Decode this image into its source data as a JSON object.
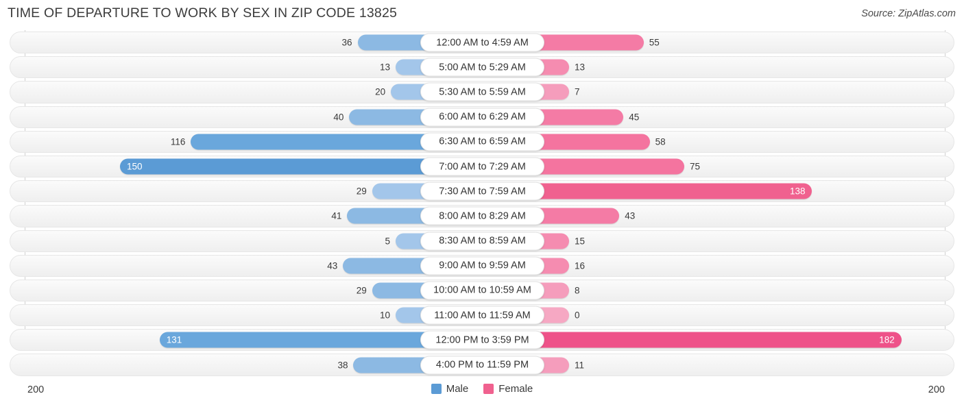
{
  "header": {
    "title": "TIME OF DEPARTURE TO WORK BY SEX IN ZIP CODE 13825",
    "source": "Source: ZipAtlas.com"
  },
  "legend": {
    "items": [
      {
        "label": "Male",
        "color": "#5b9bd5"
      },
      {
        "label": "Female",
        "color": "#f0618f"
      }
    ]
  },
  "axis": {
    "left_label": "200",
    "right_label": "200",
    "max": 200
  },
  "colors": {
    "male_light": "#a3c6ea",
    "male_mid": "#8cb9e3",
    "male_dark": "#5b9bd5",
    "female_light": "#f4a0bd",
    "female_mid": "#f happy",
    "female_dark": "#f0618f"
  },
  "chart_data": {
    "type": "bar",
    "title": "TIME OF DEPARTURE TO WORK BY SEX IN ZIP CODE 13825",
    "subtitle": "Source: ZipAtlas.com",
    "orientation": "horizontal-diverging",
    "xlabel": "",
    "ylabel": "",
    "xlim": [
      200,
      200
    ],
    "grid": false,
    "legend_position": "bottom-center",
    "categories": [
      "12:00 AM to 4:59 AM",
      "5:00 AM to 5:29 AM",
      "5:30 AM to 5:59 AM",
      "6:00 AM to 6:29 AM",
      "6:30 AM to 6:59 AM",
      "7:00 AM to 7:29 AM",
      "7:30 AM to 7:59 AM",
      "8:00 AM to 8:29 AM",
      "8:30 AM to 8:59 AM",
      "9:00 AM to 9:59 AM",
      "10:00 AM to 10:59 AM",
      "11:00 AM to 11:59 AM",
      "12:00 PM to 3:59 PM",
      "4:00 PM to 11:59 PM"
    ],
    "series": [
      {
        "name": "Male",
        "values": [
          36,
          13,
          20,
          40,
          116,
          150,
          29,
          41,
          5,
          43,
          29,
          10,
          131,
          38
        ]
      },
      {
        "name": "Female",
        "values": [
          55,
          13,
          7,
          45,
          58,
          75,
          138,
          43,
          15,
          16,
          8,
          0,
          182,
          11
        ]
      }
    ]
  },
  "rows": [
    {
      "label": "12:00 AM to 4:59 AM",
      "male": "36",
      "female": "55",
      "male_val": 36,
      "female_val": 55,
      "male_color": "#8cb9e3",
      "female_color": "#f47ba5",
      "male_inside": false,
      "female_inside": false
    },
    {
      "label": "5:00 AM to 5:29 AM",
      "male": "13",
      "female": "13",
      "male_val": 13,
      "female_val": 13,
      "male_color": "#a3c6ea",
      "female_color": "#f58cb0",
      "male_inside": false,
      "female_inside": false
    },
    {
      "label": "5:30 AM to 5:59 AM",
      "male": "20",
      "female": "7",
      "male_val": 20,
      "female_val": 7,
      "male_color": "#a3c6ea",
      "female_color": "#f59dbc",
      "male_inside": false,
      "female_inside": false
    },
    {
      "label": "6:00 AM to 6:29 AM",
      "male": "40",
      "female": "45",
      "male_val": 40,
      "female_val": 45,
      "male_color": "#8cb9e3",
      "female_color": "#f47ba5",
      "male_inside": false,
      "female_inside": false
    },
    {
      "label": "6:30 AM to 6:59 AM",
      "male": "116",
      "female": "58",
      "male_val": 116,
      "female_val": 58,
      "male_color": "#6aa7dc",
      "female_color": "#f4749f",
      "male_inside": false,
      "female_inside": false
    },
    {
      "label": "7:00 AM to 7:29 AM",
      "male": "150",
      "female": "75",
      "male_val": 150,
      "female_val": 75,
      "male_color": "#5b9bd5",
      "female_color": "#f4749f",
      "male_inside": true,
      "female_inside": false
    },
    {
      "label": "7:30 AM to 7:59 AM",
      "male": "29",
      "female": "138",
      "male_val": 29,
      "female_val": 138,
      "male_color": "#a3c6ea",
      "female_color": "#f0618f",
      "male_inside": false,
      "female_inside": true
    },
    {
      "label": "8:00 AM to 8:29 AM",
      "male": "41",
      "female": "43",
      "male_val": 41,
      "female_val": 43,
      "male_color": "#8cb9e3",
      "female_color": "#f47ba5",
      "male_inside": false,
      "female_inside": false
    },
    {
      "label": "8:30 AM to 8:59 AM",
      "male": "5",
      "female": "15",
      "male_val": 5,
      "female_val": 15,
      "male_color": "#a3c6ea",
      "female_color": "#f58cb0",
      "male_inside": false,
      "female_inside": false
    },
    {
      "label": "9:00 AM to 9:59 AM",
      "male": "43",
      "female": "16",
      "male_val": 43,
      "female_val": 16,
      "male_color": "#8cb9e3",
      "female_color": "#f58cb0",
      "male_inside": false,
      "female_inside": false
    },
    {
      "label": "10:00 AM to 10:59 AM",
      "male": "29",
      "female": "8",
      "male_val": 29,
      "female_val": 8,
      "male_color": "#8cb9e3",
      "female_color": "#f59dbc",
      "male_inside": false,
      "female_inside": false
    },
    {
      "label": "11:00 AM to 11:59 AM",
      "male": "10",
      "female": "0",
      "male_val": 10,
      "female_val": 0,
      "male_color": "#a3c6ea",
      "female_color": "#f6a8c3",
      "male_inside": false,
      "female_inside": false
    },
    {
      "label": "12:00 PM to 3:59 PM",
      "male": "131",
      "female": "182",
      "male_val": 131,
      "female_val": 182,
      "male_color": "#6aa7dc",
      "female_color": "#ee5289",
      "male_inside": true,
      "female_inside": true
    },
    {
      "label": "4:00 PM to 11:59 PM",
      "male": "38",
      "female": "11",
      "male_val": 38,
      "female_val": 11,
      "male_color": "#8cb9e3",
      "female_color": "#f59dbc",
      "male_inside": false,
      "female_inside": false
    }
  ]
}
